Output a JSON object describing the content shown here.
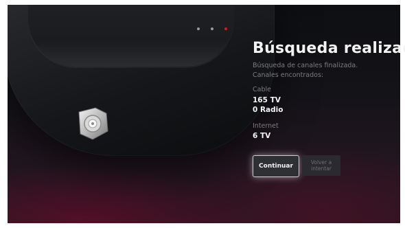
{
  "pagination": {
    "total": 3,
    "active_index": 3
  },
  "title": "Búsqueda realizada",
  "subtitle_line1": "Búsqueda de canales finalizada.",
  "subtitle_line2": "Canales encontrados:",
  "cable": {
    "label": "Cable",
    "tv": "165 TV",
    "radio": "0 Radio"
  },
  "internet": {
    "label": "Internet",
    "tv": "6 TV"
  },
  "buttons": {
    "continue_label": "Continuar",
    "retry_label": "Volver a intentar"
  },
  "colors": {
    "accent_red": "#e2141a",
    "title_text": "#f2f2f2",
    "muted_text": "#7d7c82"
  }
}
